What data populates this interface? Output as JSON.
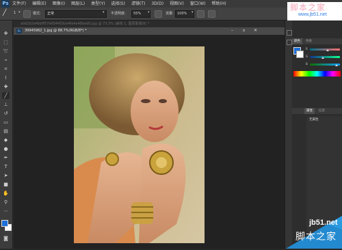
{
  "app": {
    "logo": "Ps"
  },
  "menu": [
    "文件(F)",
    "编辑(E)",
    "图像(I)",
    "图层(L)",
    "类型(Y)",
    "选择(S)",
    "滤镜(T)",
    "3D(D)",
    "视图(V)",
    "窗口(W)",
    "帮助(H)"
  ],
  "options": {
    "brush_size": "1",
    "mode_label": "模式:",
    "mode_value": "正常",
    "opacity_label": "不透明度:",
    "opacity_value": "55%",
    "flow_label": "流量:",
    "flow_value": "100%"
  },
  "documents": {
    "hidden_tab_title": "a0d2b2e4bbff57e654459ce4fa4a48bed0.jpg @ 73.3% (曲线 1, 图层蒙版/8) *",
    "active_title": "39945962_1.jpg @ 88.7%(RGB/8*) *"
  },
  "panels": {
    "color_tabs": [
      "颜色",
      "色板"
    ],
    "properties_tabs": [
      "属性",
      "信息"
    ],
    "properties_empty": "无属性"
  },
  "colors": {
    "foreground": "#1d6fd6",
    "background": "#ffffff",
    "accent": "#2a8cf0"
  },
  "watermark": {
    "top_text": "脚本之家",
    "top_url": "www.jb51.net",
    "bottom_url": "jb51.net",
    "bottom_text": "脚本之家"
  }
}
